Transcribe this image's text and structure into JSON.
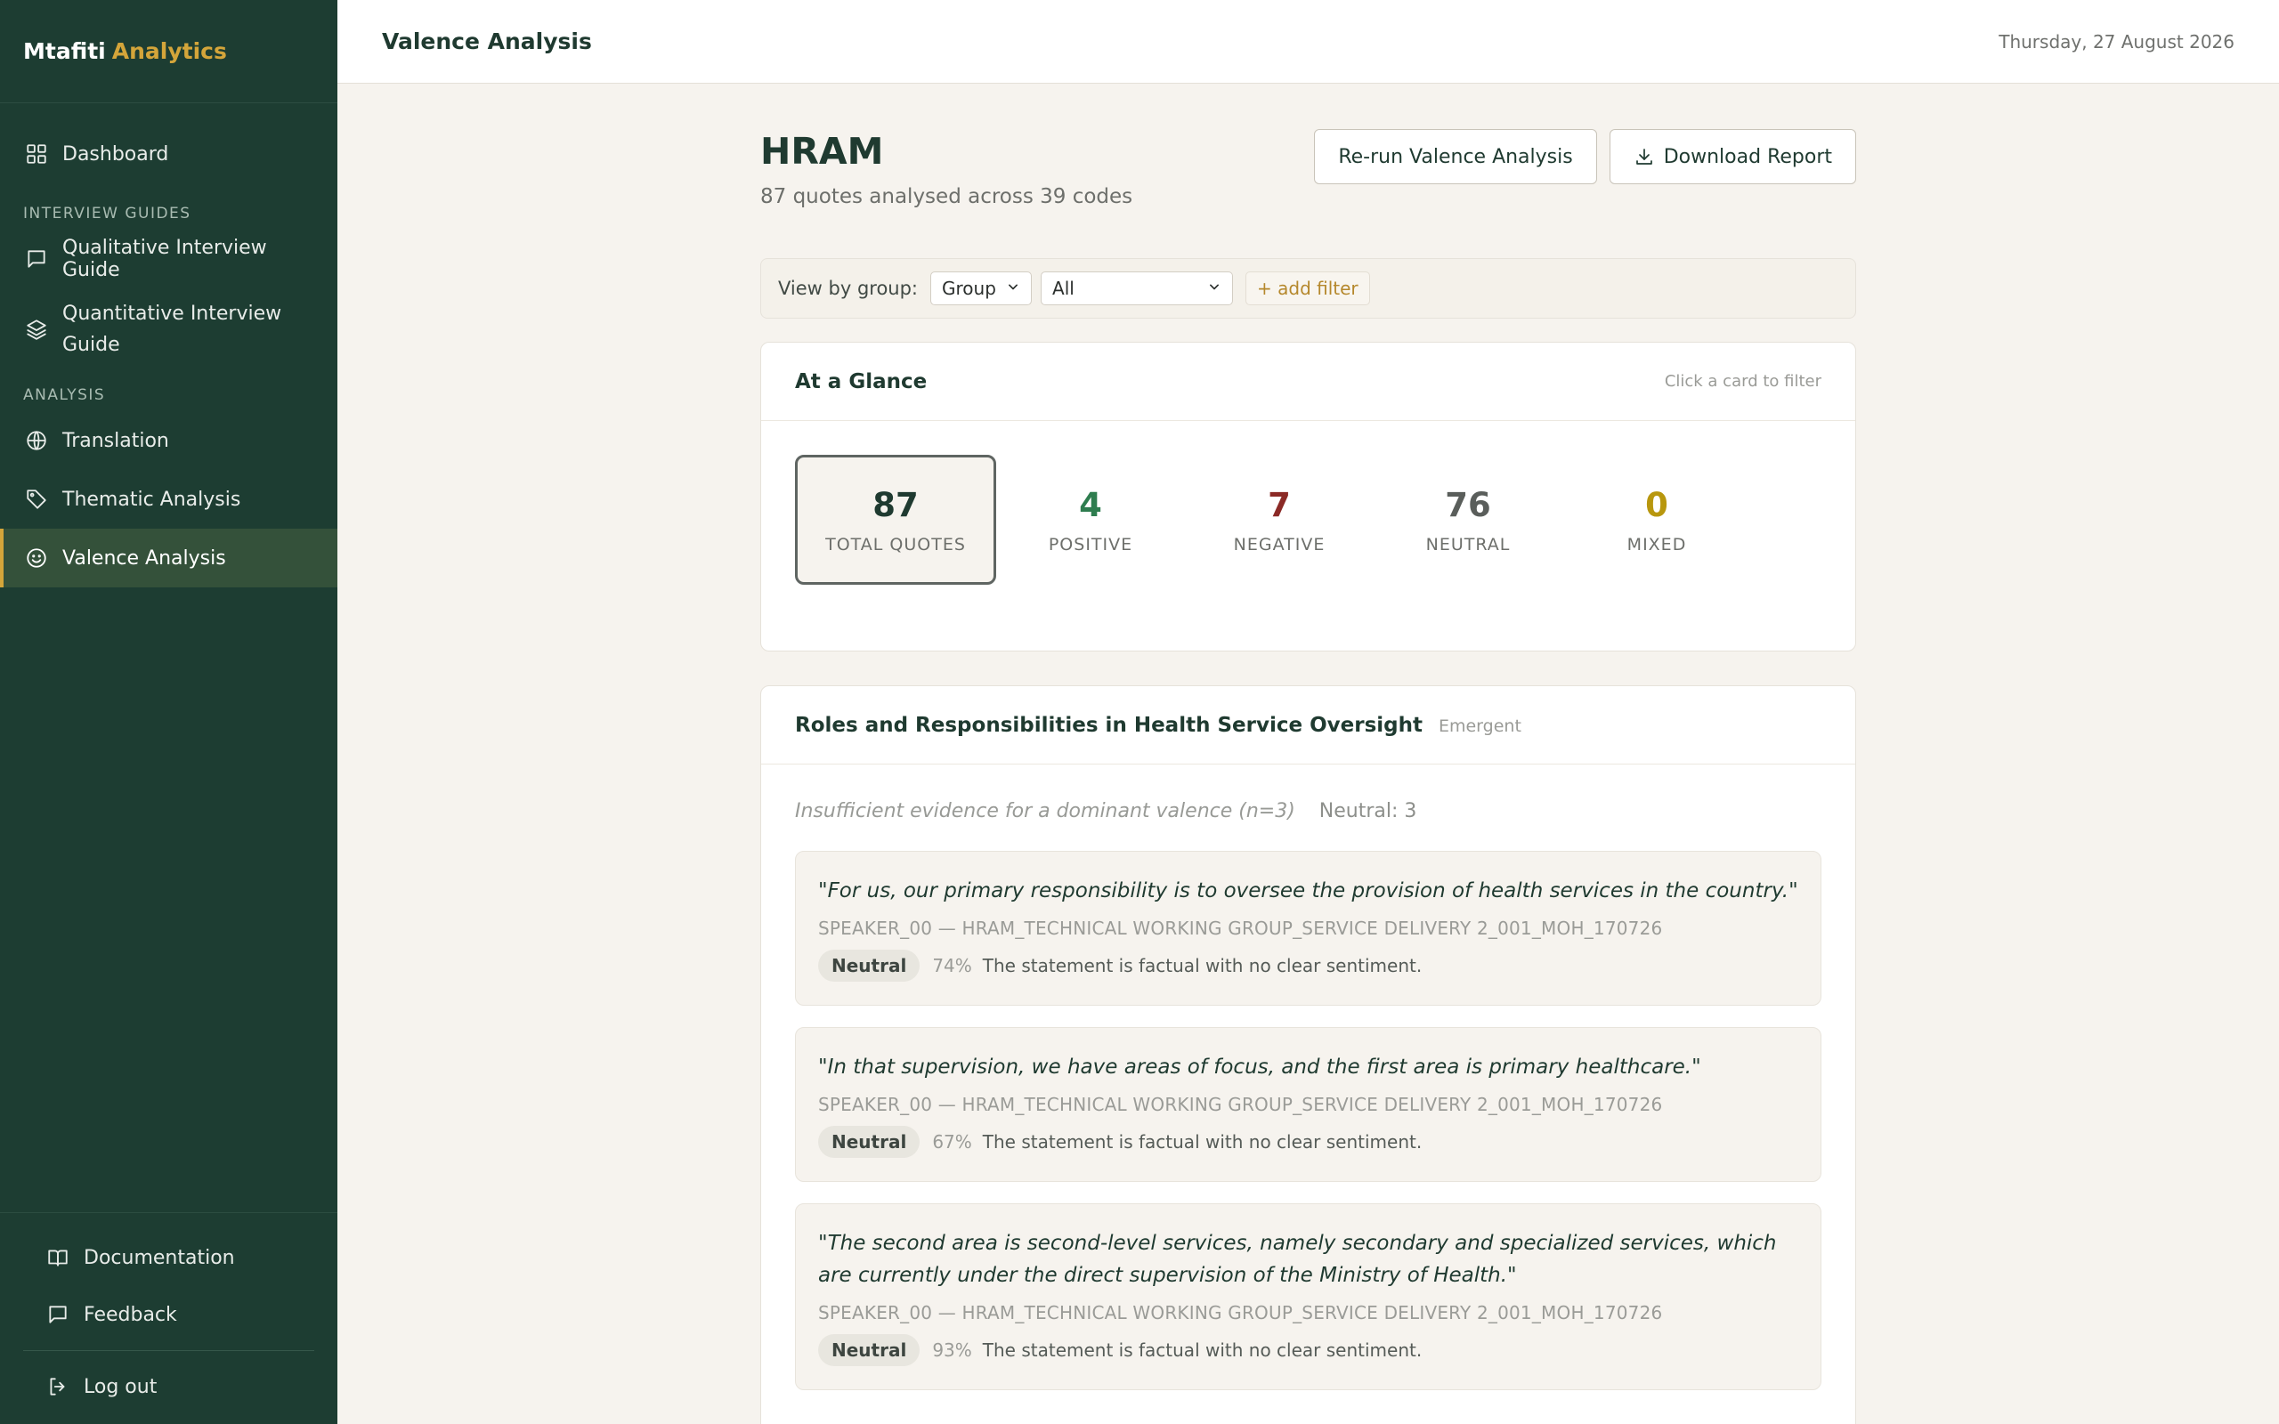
{
  "brand": {
    "name": "Mtafiti",
    "accent": "Analytics"
  },
  "nav": {
    "dashboard": "Dashboard",
    "section_guides": "INTERVIEW GUIDES",
    "qualitative": "Qualitative Interview Guide",
    "quantitative": "Quantitative Interview Guide",
    "section_analysis": "ANALYSIS",
    "translation": "Translation",
    "thematic": "Thematic Analysis",
    "valence": "Valence Analysis",
    "documentation": "Documentation",
    "feedback": "Feedback",
    "logout": "Log out"
  },
  "topbar": {
    "title": "Valence Analysis",
    "date": "Thursday, 27 August 2026"
  },
  "page": {
    "title": "HRAM",
    "subtitle": "87 quotes analysed across 39 codes"
  },
  "actions": {
    "rerun": "Re-run Valence Analysis",
    "download": "Download Report"
  },
  "filters": {
    "label": "View by group:",
    "group_value": "Group",
    "all_value": "All",
    "add": "+ add filter"
  },
  "glance": {
    "title": "At a Glance",
    "hint": "Click a card to filter",
    "stats": [
      {
        "value": "87",
        "label": "TOTAL QUOTES",
        "color": "#1f3a30"
      },
      {
        "value": "4",
        "label": "POSITIVE",
        "color": "#2e7d4f"
      },
      {
        "value": "7",
        "label": "NEGATIVE",
        "color": "#8b2a26"
      },
      {
        "value": "76",
        "label": "NEUTRAL",
        "color": "#5a5e5b"
      },
      {
        "value": "0",
        "label": "MIXED",
        "color": "#b8970e"
      }
    ]
  },
  "code": {
    "title": "Roles and Responsibilities in Health Service Oversight",
    "tag": "Emergent",
    "summary": "Insufficient evidence for a dominant valence (n=3)",
    "count": "Neutral: 3",
    "quotes": [
      {
        "text": "\"For us, our primary responsibility is to oversee the provision of health services in the country.\"",
        "source": "SPEAKER_00 — HRAM_TECHNICAL WORKING GROUP_SERVICE DELIVERY 2_001_MOH_170726",
        "label": "Neutral",
        "pct": "74%",
        "reason": "The statement is factual with no clear sentiment."
      },
      {
        "text": "\"In that supervision, we have areas of focus, and the first area is primary healthcare.\"",
        "source": "SPEAKER_00 — HRAM_TECHNICAL WORKING GROUP_SERVICE DELIVERY 2_001_MOH_170726",
        "label": "Neutral",
        "pct": "67%",
        "reason": "The statement is factual with no clear sentiment."
      },
      {
        "text": "\"The second area is second-level services, namely secondary and specialized services, which are currently under the direct supervision of the Ministry of Health.\"",
        "source": "SPEAKER_00 — HRAM_TECHNICAL WORKING GROUP_SERVICE DELIVERY 2_001_MOH_170726",
        "label": "Neutral",
        "pct": "93%",
        "reason": "The statement is factual with no clear sentiment."
      }
    ]
  }
}
